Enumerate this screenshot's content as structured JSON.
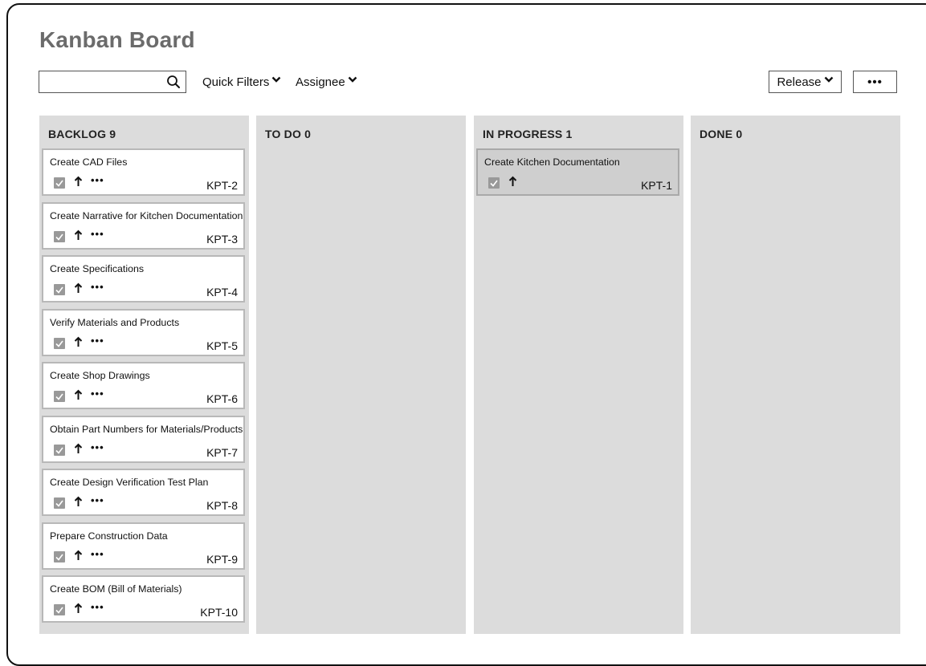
{
  "header": {
    "title": "Kanban Board"
  },
  "toolbar": {
    "search": {
      "value": "",
      "placeholder": ""
    },
    "quick_filters_label": "Quick Filters",
    "assignee_label": "Assignee",
    "release_label": "Release",
    "more_label": "•••"
  },
  "columns": [
    {
      "name": "BACKLOG 9",
      "cards": [
        {
          "title": "Create CAD Files",
          "key": "KPT-2"
        },
        {
          "title": "Create Narrative for Kitchen Documentation",
          "key": "KPT-3"
        },
        {
          "title": "Create Specifications",
          "key": "KPT-4"
        },
        {
          "title": "Verify Materials and Products",
          "key": "KPT-5"
        },
        {
          "title": "Create Shop Drawings",
          "key": "KPT-6"
        },
        {
          "title": "Obtain Part Numbers for Materials/Products",
          "key": "KPT-7"
        },
        {
          "title": "Create Design Verification Test Plan",
          "key": "KPT-8"
        },
        {
          "title": "Prepare Construction Data",
          "key": "KPT-9"
        },
        {
          "title": "Create BOM (Bill of Materials)",
          "key": "KPT-10"
        }
      ]
    },
    {
      "name": "TO DO 0",
      "cards": []
    },
    {
      "name": "IN PROGRESS 1",
      "cards": [
        {
          "title": "Create Kitchen Documentation",
          "key": "KPT-1"
        }
      ]
    },
    {
      "name": "DONE 0",
      "cards": []
    }
  ],
  "card_actions": {
    "more_label": "•••"
  },
  "colors": {
    "column_bg": "#dcdcdc",
    "card_border": "#b8b8b8",
    "title_color": "#6b6b6b",
    "in_progress_card_bg": "#cfcfcf"
  }
}
